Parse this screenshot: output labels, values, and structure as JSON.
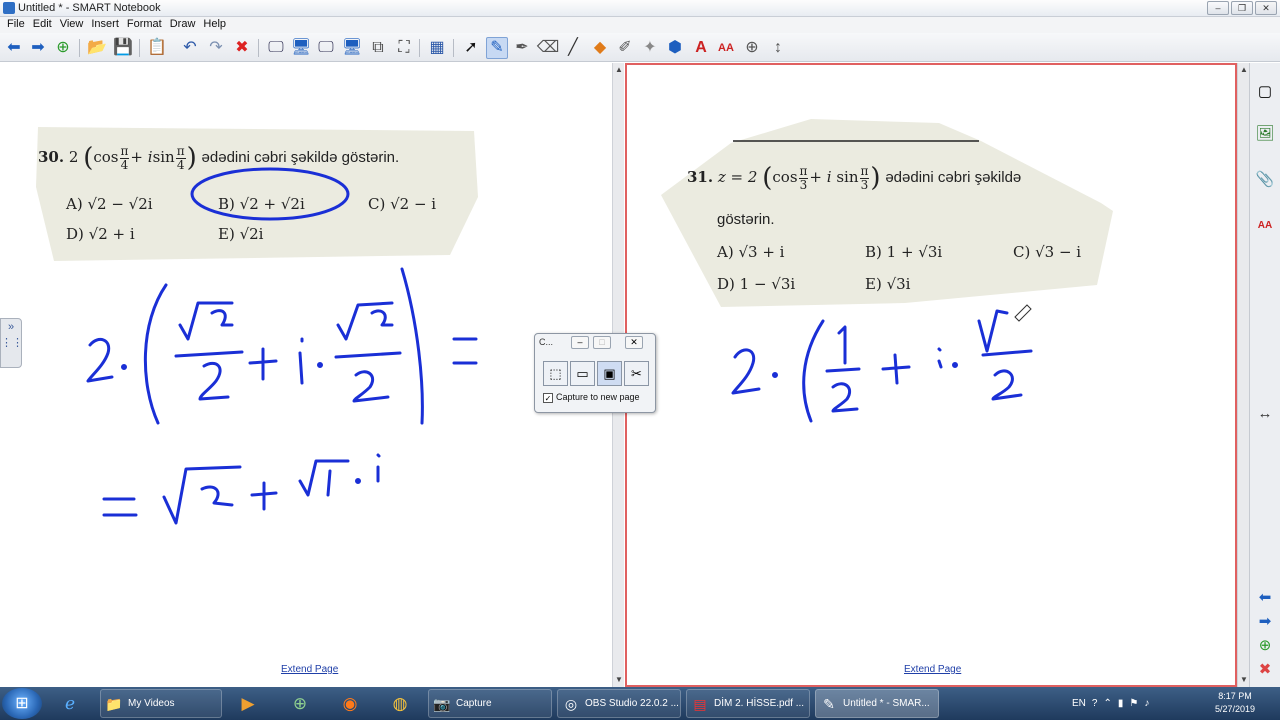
{
  "window": {
    "title": "Untitled * - SMART Notebook"
  },
  "menu": [
    "File",
    "Edit",
    "View",
    "Insert",
    "Format",
    "Draw",
    "Help"
  ],
  "left_page": {
    "question_num": "30.",
    "question_pre": "2",
    "question_text": "ədədini cəbri şəkildə göstərin.",
    "options": {
      "A": "A) √2 − √2i",
      "B": "B) √2 + √2i",
      "C": "C) √2 − i",
      "D": "D) √2 + i",
      "E": "E) √2i"
    },
    "extend_label": "Extend Page"
  },
  "right_page": {
    "question_num": "31.",
    "question_pre": "z = 2",
    "question_text": "ədədini cəbri şəkildə",
    "question_text2": "göstərin.",
    "options": {
      "A": "A) √3 + i",
      "B": "B) 1 + √3i",
      "C": "C) √3 − i",
      "D": "D) 1 − √3i",
      "E": "E) √3i"
    },
    "extend_label": "Extend Page"
  },
  "capture": {
    "title": "C...",
    "checkbox_label": "Capture to new page",
    "checked": true
  },
  "taskbar": {
    "buttons": [
      "My Videos",
      "Capture",
      "OBS Studio 22.0.2 ...",
      "DİM 2. HİSSE.pdf ...",
      "Untitled * - SMAR..."
    ],
    "lang": "EN",
    "time": "8:17 PM",
    "date": "5/27/2019"
  }
}
